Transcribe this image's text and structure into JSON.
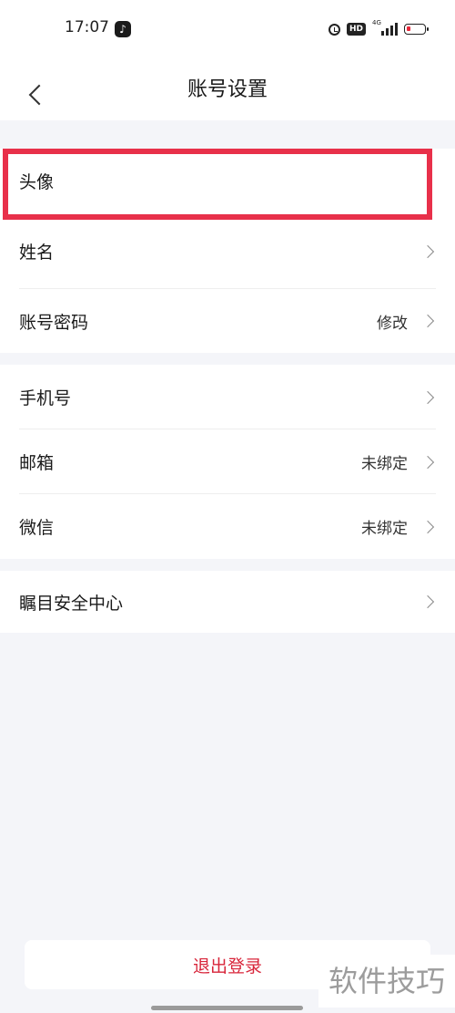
{
  "status_bar": {
    "time": "17:07",
    "app_badge": "♪",
    "hd": "HD",
    "network": "4G",
    "icons": [
      "alarm-icon",
      "hd-badge",
      "signal-icon",
      "battery-icon"
    ]
  },
  "nav": {
    "back_icon": "chevron-left-icon",
    "title": "账号设置"
  },
  "group1": {
    "items": [
      {
        "label": "头像",
        "value": "",
        "chevron": false
      },
      {
        "label": "姓名",
        "value": "",
        "chevron": true
      },
      {
        "label": "账号密码",
        "value": "修改",
        "chevron": true
      }
    ]
  },
  "group2": {
    "items": [
      {
        "label": "手机号",
        "value": "",
        "chevron": true
      },
      {
        "label": "邮箱",
        "value": "未绑定",
        "chevron": true
      },
      {
        "label": "微信",
        "value": "未绑定",
        "chevron": true
      }
    ]
  },
  "group3": {
    "items": [
      {
        "label": "瞩目安全中心",
        "value": "",
        "chevron": true
      }
    ]
  },
  "logout": {
    "label": "退出登录"
  },
  "watermark": "软件技巧",
  "colors": {
    "highlight": "#e8304a",
    "logout_text": "#d8263b",
    "background": "#f4f5f9"
  }
}
